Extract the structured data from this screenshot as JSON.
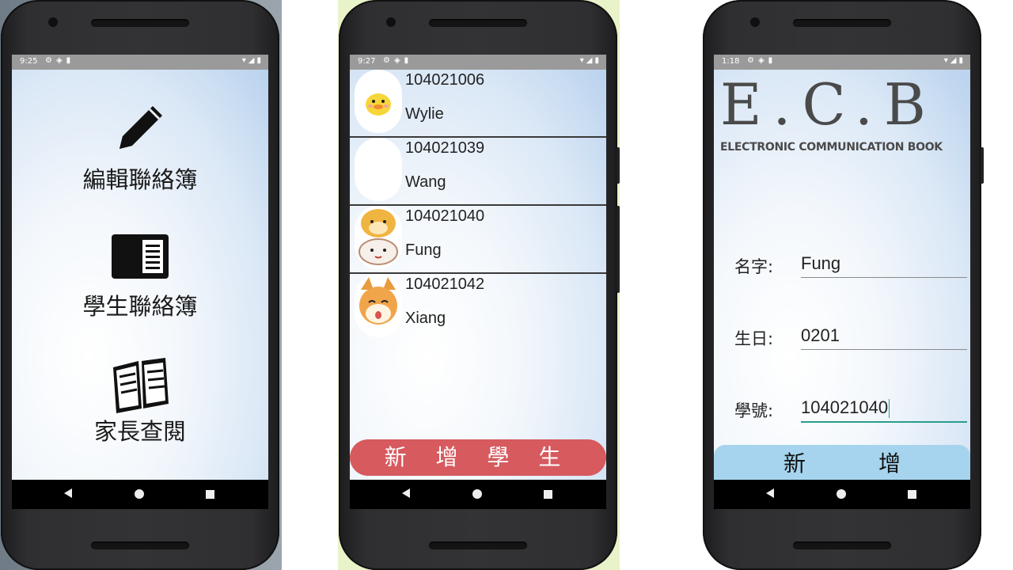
{
  "screens": [
    {
      "status_time": "9:25",
      "menu": [
        {
          "label": "編輯聯絡簿",
          "icon": "pencil-icon"
        },
        {
          "label": "學生聯絡簿",
          "icon": "notebook-icon"
        },
        {
          "label": "家長查閱",
          "icon": "open-book-icon"
        }
      ]
    },
    {
      "status_time": "9:27",
      "students": [
        {
          "id": "104021006",
          "name": "Wylie",
          "avatar": "yellow-duck-avatar"
        },
        {
          "id": "104021039",
          "name": "Wang",
          "avatar": "blank-avatar"
        },
        {
          "id": "104021040",
          "name": "Fung",
          "avatar": "dog-with-bandage-avatar"
        },
        {
          "id": "104021042",
          "name": "Xiang",
          "avatar": "shiba-dog-avatar"
        }
      ],
      "add_button": "新 增 學 生"
    },
    {
      "status_time": "1:18",
      "logo_title": "E.C.B",
      "logo_subtitle": "ELECTRONIC COMMUNICATION BOOK",
      "fields": [
        {
          "label": "名字:",
          "value": "Fung"
        },
        {
          "label": "生日:",
          "value": "0201"
        },
        {
          "label": "學號:",
          "value": "104021040"
        }
      ],
      "submit_button": "新　增"
    }
  ],
  "colors": {
    "add_student_button": "#d65a5e",
    "submit_button": "#a6d4ee",
    "active_underline": "#2a9d8f"
  }
}
